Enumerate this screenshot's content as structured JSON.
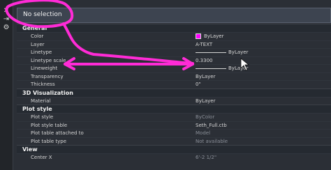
{
  "selection": {
    "label": "No selection"
  },
  "side_icons": [
    {
      "glyph": "✕",
      "name": "close-icon"
    },
    {
      "glyph": "⇥",
      "name": "auto-hide-icon"
    },
    {
      "glyph": "⚙",
      "name": "properties-icon"
    }
  ],
  "sections": [
    {
      "title": "General",
      "rows": [
        {
          "label": "Color",
          "value": "ByLayer",
          "swatch": "#ff00ff"
        },
        {
          "label": "Layer",
          "value": "A-TEXT"
        },
        {
          "label": "Linetype",
          "value": "ByLayer",
          "line": true
        },
        {
          "label": "Linetype scale",
          "value": "0.3300"
        },
        {
          "label": "Lineweight",
          "value": "ByLayer",
          "line": true
        },
        {
          "label": "Transparency",
          "value": "ByLayer"
        },
        {
          "label": "Thickness",
          "value": "0\""
        }
      ]
    },
    {
      "title": "3D Visualization",
      "rows": [
        {
          "label": "Material",
          "value": "ByLayer"
        }
      ]
    },
    {
      "title": "Plot style",
      "rows": [
        {
          "label": "Plot style",
          "value": "ByColor",
          "muted": true
        },
        {
          "label": "Plot style table",
          "value": "Seth_Full.ctb"
        },
        {
          "label": "Plot table attached to",
          "value": "Model",
          "muted": true
        },
        {
          "label": "Plot table type",
          "value": "Not available",
          "muted": true
        }
      ]
    },
    {
      "title": "View",
      "rows": [
        {
          "label": "Center X",
          "value": "6'-2 1/2\"",
          "muted": true
        }
      ]
    }
  ],
  "colors": {
    "annotation": "#ff2bd6",
    "swatch": "#ff00ff"
  }
}
